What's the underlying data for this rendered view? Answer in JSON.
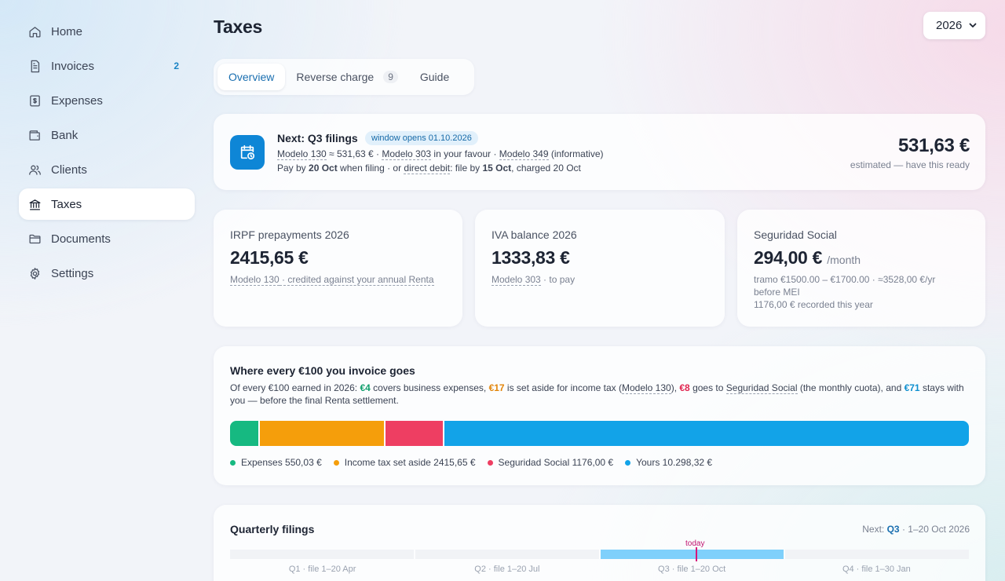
{
  "sidebar": {
    "items": [
      {
        "label": "Home",
        "icon": "home-icon"
      },
      {
        "label": "Invoices",
        "icon": "invoice-icon",
        "count": "2"
      },
      {
        "label": "Expenses",
        "icon": "dollar-receipt-icon"
      },
      {
        "label": "Bank",
        "icon": "wallet-icon"
      },
      {
        "label": "Clients",
        "icon": "users-icon"
      },
      {
        "label": "Taxes",
        "icon": "bank-building-icon",
        "active": true
      },
      {
        "label": "Documents",
        "icon": "folder-icon"
      },
      {
        "label": "Settings",
        "icon": "gear-icon"
      }
    ]
  },
  "header": {
    "title": "Taxes",
    "year": "2026"
  },
  "tabs": [
    {
      "label": "Overview",
      "active": true
    },
    {
      "label": "Reverse charge",
      "count": "9"
    },
    {
      "label": "Guide"
    }
  ],
  "next": {
    "title": "Next: Q3 filings",
    "badge": "window opens 01.10.2026",
    "line1_a": "Modelo 130",
    "line1_b": " ≈ 531,63 € · ",
    "line1_c": "Modelo 303",
    "line1_d": " in your favour · ",
    "line1_e": "Modelo 349",
    "line1_f": " (informative)",
    "line2_a": "Pay by ",
    "line2_b": "20 Oct",
    "line2_c": " when filing · or ",
    "line2_d": "direct debit",
    "line2_e": ": file by ",
    "line2_f": "15 Oct",
    "line2_g": ", charged 20 Oct",
    "amount": "531,63 €",
    "note": "estimated — have this ready"
  },
  "stats": {
    "irpf": {
      "label": "IRPF prepayments 2026",
      "value": "2415,65 €",
      "sub_link": "Modelo 130",
      "sub_rest": " · credited against your annual Renta"
    },
    "iva": {
      "label": "IVA balance 2026",
      "value": "1333,83 €",
      "sub_link": "Modelo 303",
      "sub_rest": " · to pay"
    },
    "ss": {
      "label": "Seguridad Social",
      "value": "294,00 €",
      "unit": "/month",
      "sub1": "tramo €1500.00 – €1700.00 · ≈3528,00 €/yr before MEI",
      "sub2": "1176,00 € recorded this year"
    }
  },
  "breakdown": {
    "title": "Where every €100 you invoice goes",
    "d1": "Of every €100 earned in 2026: ",
    "a1": "€4",
    "d2": " covers business expenses, ",
    "a2": "€17",
    "d3": " is set aside for income tax (",
    "l1": "Modelo 130",
    "d4": "), ",
    "a3": "€8",
    "d5": " goes to ",
    "l2": "Seguridad Social",
    "d6": " (the monthly cuota), and ",
    "a4": "€71",
    "d7": " stays with you — before the final Renta settlement.",
    "segments": [
      {
        "name": "Expenses",
        "share": 4,
        "color": "#16b981",
        "legend": "Expenses 550,03 €"
      },
      {
        "name": "Income tax",
        "share": 17,
        "color": "#f59e0b",
        "legend": "Income tax set aside 2415,65 €"
      },
      {
        "name": "Seguridad Social",
        "share": 8,
        "color": "#ee3e62",
        "legend": "Seguridad Social 1176,00 €"
      },
      {
        "name": "Yours",
        "share": 71,
        "color": "#12a3e8",
        "legend": "Yours 10.298,32 €"
      }
    ],
    "amount_colors": {
      "expenses": "#0f9e6c",
      "tax": "#e2850a",
      "ss": "#e0244e",
      "yours": "#0e8fcf"
    }
  },
  "quarterly": {
    "title": "Quarterly filings",
    "next_prefix": "Next: ",
    "next_q": "Q3",
    "next_range": " · 1–20 Oct 2026",
    "today": "today",
    "quarters": [
      "Q1 · file 1–20 Apr",
      "Q2 · file 1–20 Jul",
      "Q3 · file 1–20 Oct",
      "Q4 · file 1–30 Jan"
    ],
    "current_index": 2
  }
}
